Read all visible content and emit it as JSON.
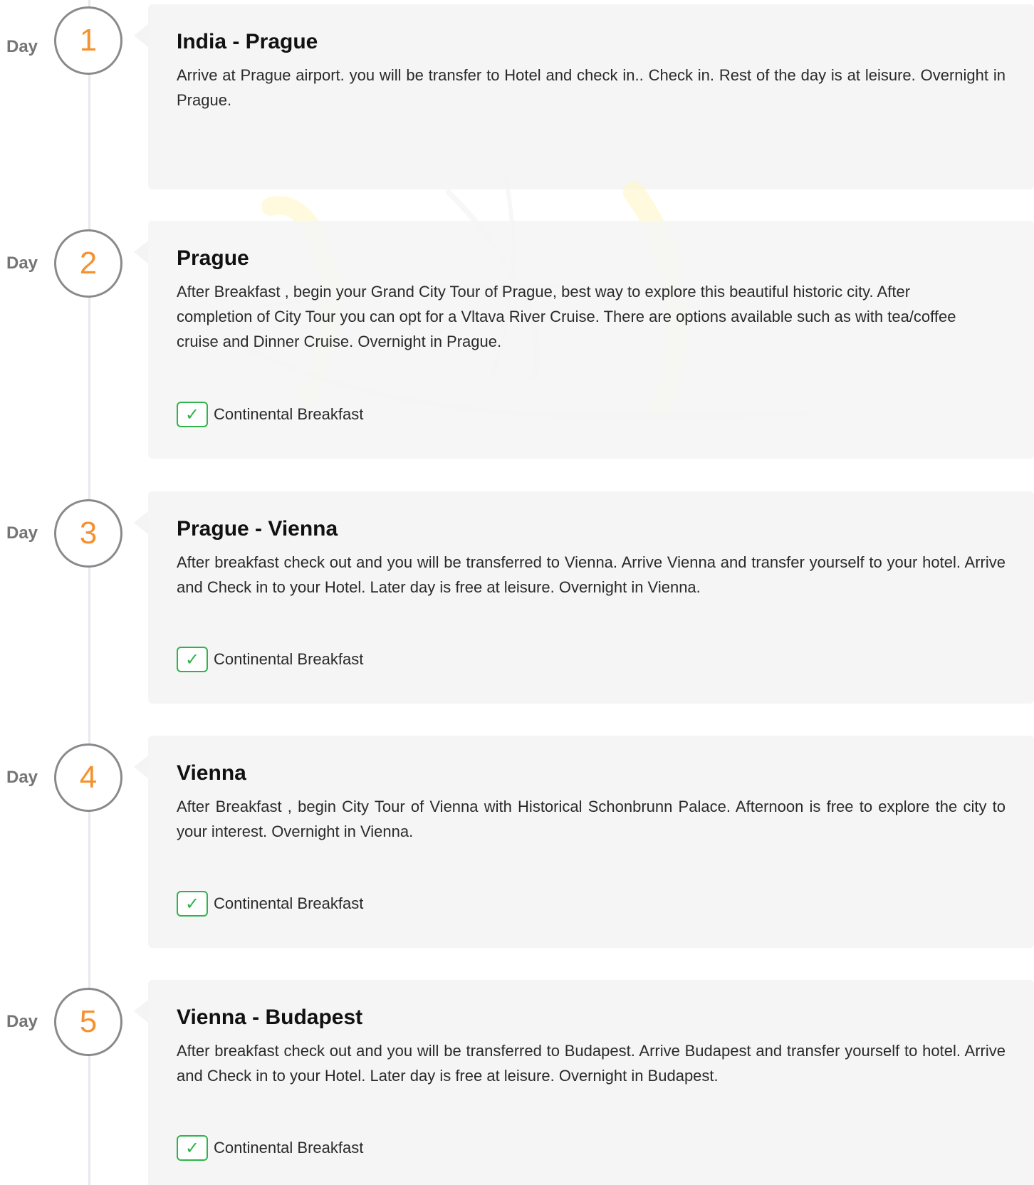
{
  "day_word": "Day",
  "check_glyph": "✓",
  "days": [
    {
      "number": "1",
      "title": "India - Prague",
      "description": "Arrive at Prague airport. you will be transfer to Hotel and check in.. Check in. Rest of the day is at leisure. Overnight in Prague.",
      "meal": ""
    },
    {
      "number": "2",
      "title": "Prague",
      "description": "After Breakfast , begin your Grand City Tour of Prague, best way to explore this beautiful historic city. After completion of City Tour you can opt for a Vltava River Cruise. There are options available such as with tea/coffee cruise and Dinner Cruise. Overnight in Prague.",
      "meal": "Continental Breakfast"
    },
    {
      "number": "3",
      "title": "Prague - Vienna",
      "description": "After breakfast check out and you will be transferred to Vienna. Arrive Vienna and transfer yourself to your hotel. Arrive and Check in to your Hotel. Later day is free at leisure. Overnight in Vienna.",
      "meal": "Continental Breakfast"
    },
    {
      "number": "4",
      "title": "Vienna",
      "description": "After Breakfast , begin City Tour of Vienna with Historical Schonbrunn Palace. Afternoon is free to explore the city to your interest. Overnight in Vienna.",
      "meal": "Continental Breakfast"
    },
    {
      "number": "5",
      "title": "Vienna - Budapest",
      "description": "After breakfast check out and you will be transferred to Budapest. Arrive Budapest and transfer yourself to hotel. Arrive and Check in to your Hotel. Later day is free at leisure. Overnight in Budapest.",
      "meal": "Continental Breakfast"
    }
  ],
  "colors": {
    "day_number": "#f5922f",
    "check": "#2fb34a",
    "card_bg": "#f5f5f5",
    "circle_border": "#8a8a8a"
  }
}
